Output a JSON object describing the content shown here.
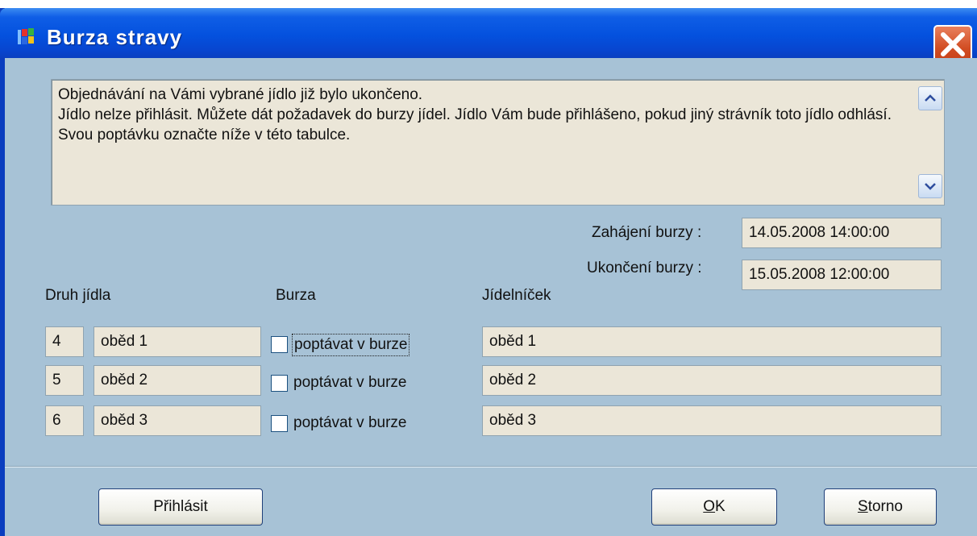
{
  "window": {
    "title": "Burza stravy"
  },
  "message": {
    "lines": "Objednávání na Vámi vybrané jídlo již bylo ukončeno.\nJídlo nelze přihlásit. Můžete dát požadavek do burzy jídel. Jídlo Vám bude přihlášeno, pokud jiný strávník toto jídlo odhlásí. Svou poptávku označte níže v této tabulce."
  },
  "exchange": {
    "start_label": "Zahájení burzy :",
    "start_value": "14.05.2008 14:00:00",
    "end_label": "Ukončení burzy :",
    "end_value": "15.05.2008 12:00:00"
  },
  "table": {
    "headers": {
      "meal_type": "Druh jídla",
      "exchange": "Burza",
      "menu": "Jídelníček"
    },
    "rows": [
      {
        "num": "4",
        "type": "oběd 1",
        "checkbox_label": "poptávat v burze",
        "checked": false,
        "menu": "oběd 1"
      },
      {
        "num": "5",
        "type": "oběd 2",
        "checkbox_label": "poptávat v burze",
        "checked": false,
        "menu": "oběd 2"
      },
      {
        "num": "6",
        "type": "oběd 3",
        "checkbox_label": "poptávat v burze",
        "checked": false,
        "menu": "oběd 3"
      }
    ]
  },
  "buttons": {
    "register": "Přihlásit",
    "ok_mnemonic": "O",
    "ok_rest": "K",
    "cancel_mnemonic": "S",
    "cancel_rest": "torno"
  },
  "icons": {
    "app": "windows-logo-icon",
    "close": "close-icon",
    "scroll_up": "scroll-up-icon",
    "scroll_down": "scroll-down-icon"
  },
  "colors": {
    "titlebar": "#0451de",
    "dialog_bg": "#a7c2d6",
    "field_bg": "#ebe6d8",
    "close_btn": "#d24e24"
  }
}
